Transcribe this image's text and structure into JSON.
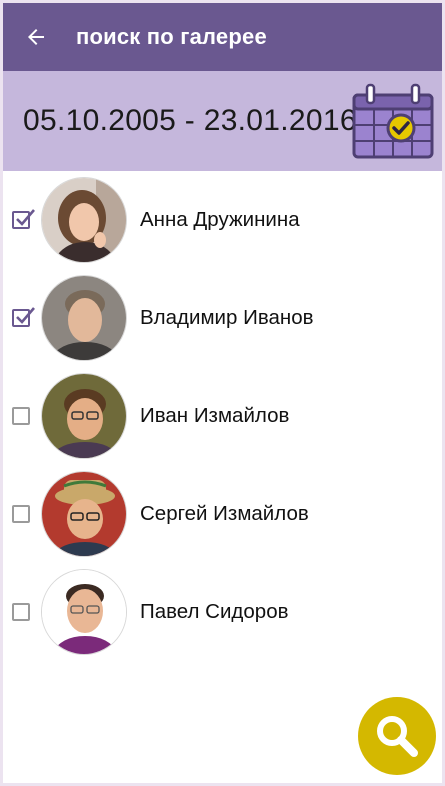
{
  "appbar": {
    "title": "поиск по галерее",
    "back_icon": "arrow-left-icon"
  },
  "filter": {
    "date_range": "05.10.2005 - 23.01.2016",
    "calendar_icon": "calendar-check-icon"
  },
  "people": [
    {
      "name": "Анна Дружинина",
      "checked": true
    },
    {
      "name": "Владимир Иванов",
      "checked": true
    },
    {
      "name": "Иван Измайлов",
      "checked": false
    },
    {
      "name": "Сергей Измайлов",
      "checked": false
    },
    {
      "name": "Павел Сидоров",
      "checked": false
    }
  ],
  "fab": {
    "icon": "search-icon"
  },
  "colors": {
    "appbar": "#6a5890",
    "filter_bar": "#c5b7dc",
    "accent_fab": "#d4b800",
    "checkbox_checked": "#6a5890"
  }
}
